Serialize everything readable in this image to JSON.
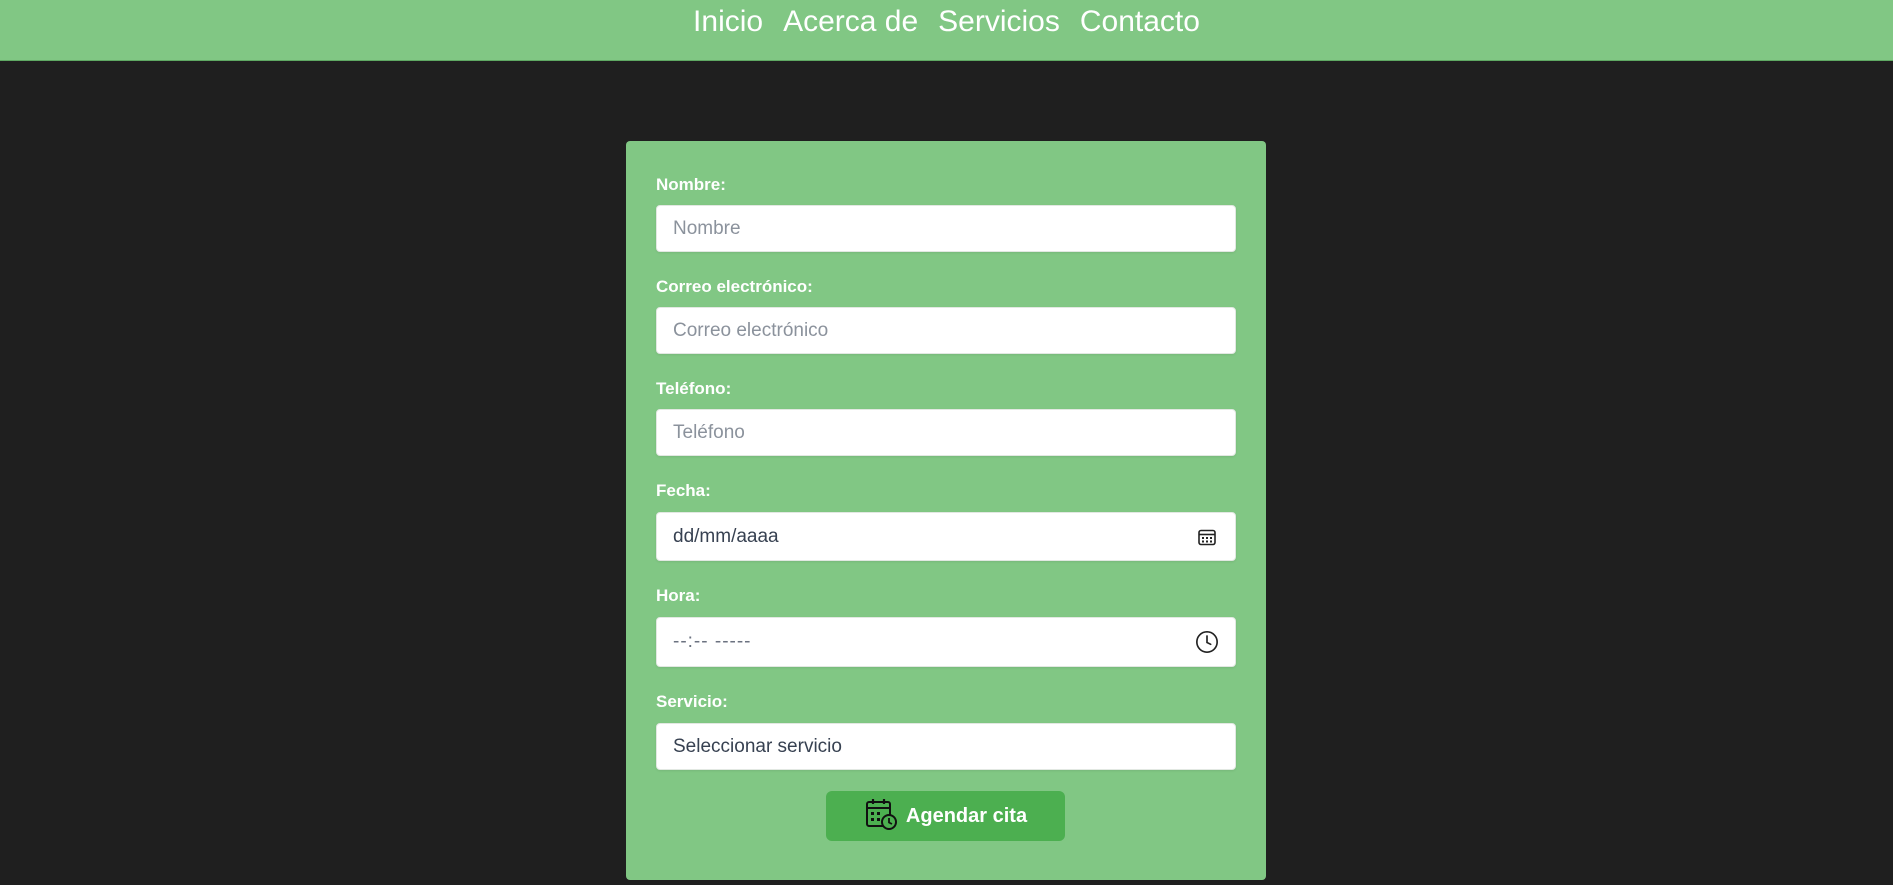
{
  "nav": {
    "items": [
      {
        "label": "Inicio"
      },
      {
        "label": "Acerca de"
      },
      {
        "label": "Servicios"
      },
      {
        "label": "Contacto"
      }
    ]
  },
  "form": {
    "nombre": {
      "label": "Nombre:",
      "placeholder": "Nombre",
      "value": ""
    },
    "correo": {
      "label": "Correo electrónico:",
      "placeholder": "Correo electrónico",
      "value": ""
    },
    "telefono": {
      "label": "Teléfono:",
      "placeholder": "Teléfono",
      "value": ""
    },
    "fecha": {
      "label": "Fecha:",
      "value": "dd/mm/aaaa",
      "icon": "calendar-icon"
    },
    "hora": {
      "label": "Hora:",
      "value": "--:-- -----",
      "icon": "clock-icon"
    },
    "servicio": {
      "label": "Servicio:",
      "selected": "Seleccionar servicio"
    },
    "submit": {
      "label": "Agendar cita",
      "icon": "calendar-clock-icon"
    }
  },
  "colors": {
    "background": "#1f1f1f",
    "nav": "#81c784",
    "card": "#81c784",
    "button": "#4caf50"
  }
}
